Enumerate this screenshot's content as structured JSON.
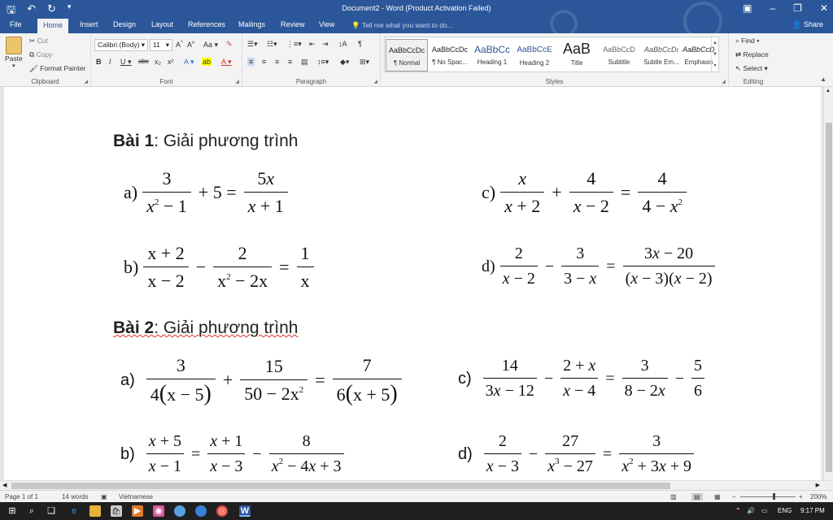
{
  "titlebar": {
    "title": "Document2 - Word (Product Activation Failed)",
    "save_icon": "save-icon",
    "undo_icon": "undo-icon",
    "redo_icon": "redo-icon"
  },
  "tabs": [
    "File",
    "Home",
    "Insert",
    "Design",
    "Layout",
    "References",
    "Mailings",
    "Review",
    "View"
  ],
  "tell_me": "Tell me what you want to do...",
  "share": "Share",
  "ribbon": {
    "clipboard": {
      "label": "Clipboard",
      "paste": "Paste",
      "cut": "Cut",
      "copy": "Copy",
      "format_painter": "Format Painter"
    },
    "font": {
      "label": "Font",
      "name": "Calibri (Body)",
      "size": "11"
    },
    "paragraph": {
      "label": "Paragraph"
    },
    "styles": {
      "label": "Styles",
      "items": [
        {
          "sample": "AaBbCcDc",
          "name": "¶ Normal"
        },
        {
          "sample": "AaBbCcDc",
          "name": "¶ No Spac..."
        },
        {
          "sample": "AaBbCc",
          "name": "Heading 1"
        },
        {
          "sample": "AaBbCcE",
          "name": "Heading 2"
        },
        {
          "sample": "AaB",
          "name": "Title"
        },
        {
          "sample": "AaBbCcD",
          "name": "Subtitle"
        },
        {
          "sample": "AaBbCcDı",
          "name": "Subtle Em..."
        },
        {
          "sample": "AaBbCcDı",
          "name": "Emphasis"
        }
      ]
    },
    "editing": {
      "label": "Editing",
      "find": "Find",
      "replace": "Replace",
      "select": "Select"
    }
  },
  "document": {
    "bai1": {
      "bold": "Bài 1",
      "rest": ": Giải phương trình"
    },
    "bai2": {
      "bold": "Bài 2",
      "rest": ": Giải phương trình"
    }
  },
  "statusbar": {
    "page": "Page 1 of 1",
    "words": "14 words",
    "language": "Vietnamese",
    "zoom": "200%"
  },
  "taskbar": {
    "lang": "ENG",
    "time": "9:17 PM"
  }
}
